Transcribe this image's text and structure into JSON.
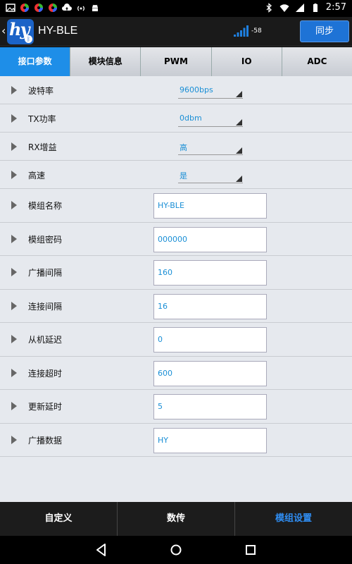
{
  "status_bar": {
    "time": "2:57"
  },
  "app": {
    "logo_text": "hy",
    "title": "HY-BLE",
    "rssi": "-58",
    "sync_label": "同步"
  },
  "tabs": [
    {
      "label": "接口参数",
      "active": true
    },
    {
      "label": "模块信息",
      "active": false
    },
    {
      "label": "PWM",
      "active": false
    },
    {
      "label": "IO",
      "active": false
    },
    {
      "label": "ADC",
      "active": false
    }
  ],
  "spinners": [
    {
      "label": "波特率",
      "value": "9600bps"
    },
    {
      "label": "TX功率",
      "value": "0dbm"
    },
    {
      "label": "RX增益",
      "value": "高"
    },
    {
      "label": "高速",
      "value": "是"
    }
  ],
  "fields": [
    {
      "label": "模组名称",
      "value": "HY-BLE"
    },
    {
      "label": "模组密码",
      "value": "000000"
    },
    {
      "label": "广播间隔",
      "value": "160"
    },
    {
      "label": "连接间隔",
      "value": "16"
    },
    {
      "label": "从机延迟",
      "value": "0"
    },
    {
      "label": "连接超时",
      "value": "600"
    },
    {
      "label": "更新延时",
      "value": "5"
    },
    {
      "label": "广播数据",
      "value": "HY"
    }
  ],
  "bottom_nav": [
    {
      "label": "自定义",
      "active": false
    },
    {
      "label": "数传",
      "active": false
    },
    {
      "label": "模组设置",
      "active": true
    }
  ],
  "colors": {
    "accent": "#1e8ee8",
    "value_text": "#1a8fd6",
    "active_nav": "#2f8cf0"
  }
}
